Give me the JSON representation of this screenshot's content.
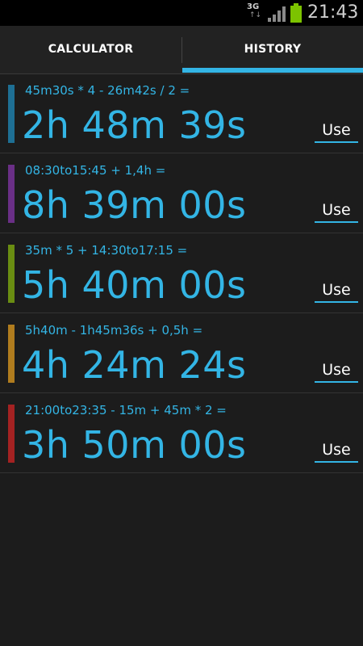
{
  "status_bar": {
    "network": "3G",
    "network_arrows": "↑↓",
    "time": "21:43",
    "battery_color": "#7cc300"
  },
  "tabs": [
    {
      "label": "CALCULATOR",
      "selected": false
    },
    {
      "label": "HISTORY",
      "selected": true
    }
  ],
  "accent_color": "#33b5e5",
  "history": [
    {
      "expression": "45m30s * 4 - 26m42s / 2 =",
      "result": "2h 48m 39s",
      "use_label": "Use",
      "bar_color": "#1e6f94"
    },
    {
      "expression": "08:30to15:45 + 1,4h =",
      "result": "8h 39m 00s",
      "use_label": "Use",
      "bar_color": "#6a2f86"
    },
    {
      "expression": "35m * 5 + 14:30to17:15 =",
      "result": "5h 40m 00s",
      "use_label": "Use",
      "bar_color": "#6a8d12"
    },
    {
      "expression": "5h40m - 1h45m36s + 0,5h =",
      "result": "4h 24m 24s",
      "use_label": "Use",
      "bar_color": "#b07c1e"
    },
    {
      "expression": "21:00to23:35 - 15m + 45m * 2 =",
      "result": "3h 50m 00s",
      "use_label": "Use",
      "bar_color": "#a42222"
    }
  ]
}
